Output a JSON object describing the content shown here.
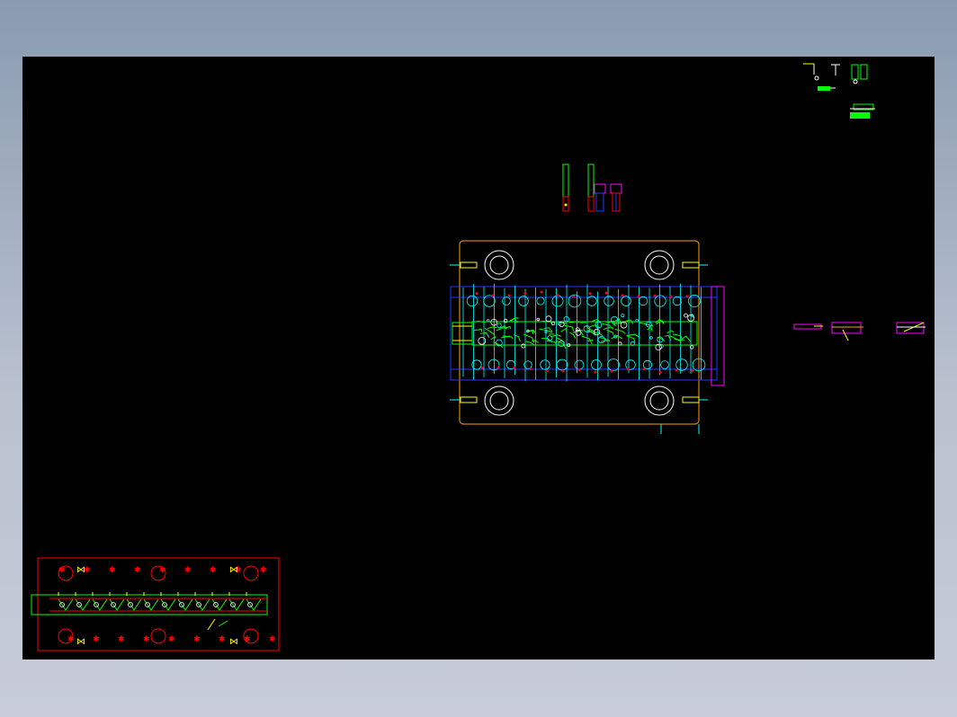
{
  "app": {
    "title": ""
  },
  "drawing": {
    "background_color": "#000000",
    "layer_colors": {
      "cyan": "#00ffff",
      "blue": "#1a3cff",
      "green": "#00ff00",
      "yellow": "#ffff00",
      "red": "#ff0000",
      "magenta": "#ff00ff",
      "orange": "#ffa500",
      "white": "#ffffff"
    },
    "views": [
      {
        "name": "die-assembly-plan-view"
      },
      {
        "name": "strip-layout-view"
      },
      {
        "name": "part-detail-views"
      },
      {
        "name": "punch-detail-views"
      },
      {
        "name": "side-section-views"
      }
    ]
  }
}
